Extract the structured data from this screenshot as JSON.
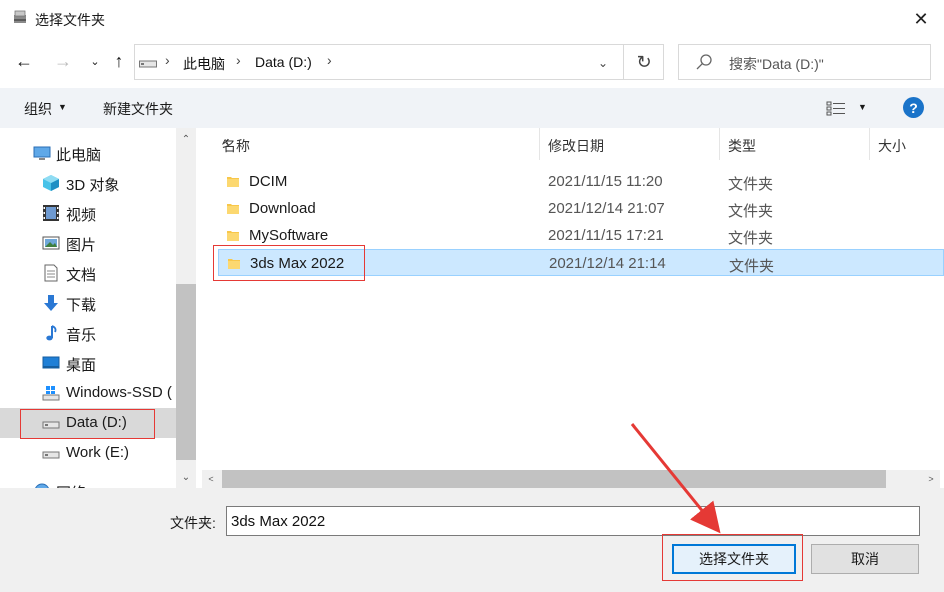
{
  "window": {
    "title": "选择文件夹"
  },
  "address": {
    "segments": [
      "此电脑",
      "Data (D:)"
    ],
    "search_placeholder": "搜索\"Data (D:)\""
  },
  "toolbar": {
    "organize": "组织",
    "new_folder": "新建文件夹"
  },
  "nav": {
    "items": [
      {
        "label": "此电脑",
        "icon": "computer-icon"
      },
      {
        "label": "3D 对象",
        "icon": "cube-icon"
      },
      {
        "label": "视频",
        "icon": "video-icon"
      },
      {
        "label": "图片",
        "icon": "picture-icon"
      },
      {
        "label": "文档",
        "icon": "document-icon"
      },
      {
        "label": "下载",
        "icon": "download-icon"
      },
      {
        "label": "音乐",
        "icon": "music-icon"
      },
      {
        "label": "桌面",
        "icon": "desktop-icon"
      },
      {
        "label": "Windows-SSD (",
        "icon": "windows-drive-icon"
      },
      {
        "label": "Data (D:)",
        "icon": "drive-icon",
        "selected": true
      },
      {
        "label": "Work (E:)",
        "icon": "drive-icon"
      },
      {
        "label": "网络",
        "icon": "network-icon"
      }
    ]
  },
  "columns": {
    "name": "名称",
    "date": "修改日期",
    "type": "类型",
    "size": "大小"
  },
  "files": [
    {
      "name": "DCIM",
      "date": "2021/11/15 11:20",
      "type": "文件夹"
    },
    {
      "name": "Download",
      "date": "2021/12/14 21:07",
      "type": "文件夹"
    },
    {
      "name": "MySoftware",
      "date": "2021/11/15 17:21",
      "type": "文件夹"
    },
    {
      "name": "3ds Max 2022",
      "date": "2021/12/14 21:14",
      "type": "文件夹",
      "selected": true
    }
  ],
  "bottom": {
    "folder_label": "文件夹:",
    "folder_value": "3ds Max 2022",
    "select_button": "选择文件夹",
    "cancel_button": "取消"
  },
  "colors": {
    "accent": "#0078d7",
    "selection": "#cce8ff",
    "annotation": "#e53935",
    "folder": "#f8c74a"
  }
}
